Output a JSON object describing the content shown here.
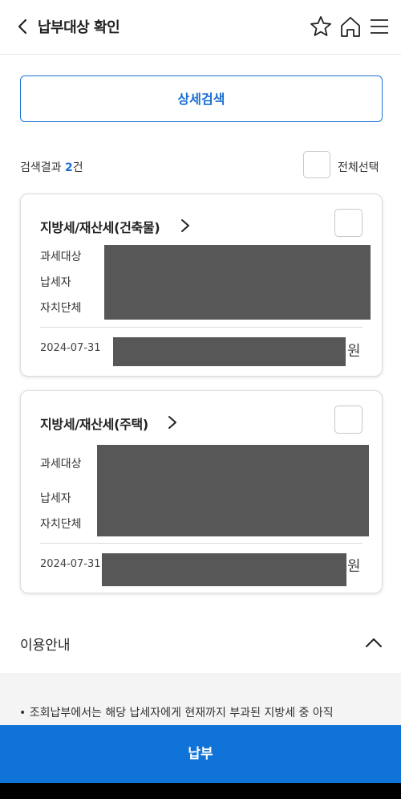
{
  "header": {
    "title": "납부대상 확인",
    "icons": [
      "back-icon",
      "star-icon",
      "home-icon",
      "menu-icon"
    ]
  },
  "search": {
    "detail_label": "상세검색"
  },
  "results": {
    "label": "검색결과",
    "count": "2",
    "unit": "건",
    "select_all_label": "전체선택"
  },
  "cards": [
    {
      "title": "지방세/재산세(건축물)",
      "labels": [
        "과세대상",
        "납세자",
        "자치단체"
      ],
      "date": "2024-07-31",
      "currency": "원"
    },
    {
      "title": "지방세/재산세(주택)",
      "labels": [
        "과세대상",
        "납세자",
        "자치단체"
      ],
      "date": "2024-07-31",
      "currency": "원"
    }
  ],
  "usage": {
    "title": "이용안내",
    "text": "•  조회납부에서는 해당 납세자에게 현재까지 부과된 지방세 중 아직"
  },
  "pay_button_label": "납부",
  "colors": {
    "accent": "#0f73d8",
    "redaction": "#575757"
  }
}
